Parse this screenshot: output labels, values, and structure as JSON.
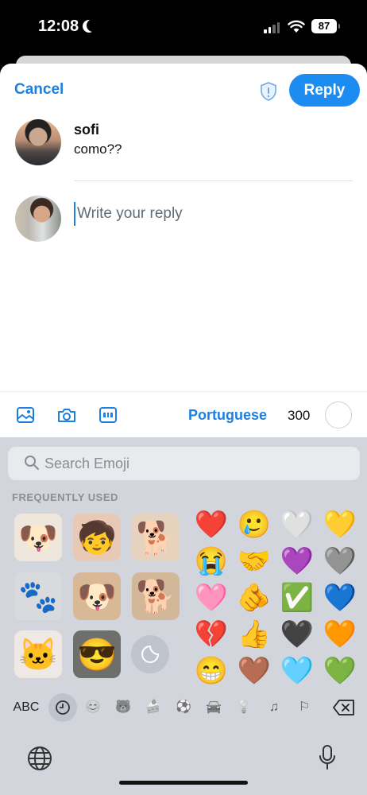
{
  "status_bar": {
    "time": "12:08",
    "battery": "87"
  },
  "header": {
    "cancel_label": "Cancel",
    "reply_label": "Reply"
  },
  "thread": {
    "user_name": "sofi",
    "message": "como??"
  },
  "composer": {
    "placeholder": "Write your reply"
  },
  "toolbar": {
    "language": "Portuguese",
    "char_count": "300"
  },
  "keyboard": {
    "search_placeholder": "Search Emoji",
    "section_label": "FREQUENTLY USED",
    "abc_label": "ABC",
    "stickers": [
      "🐶",
      "🧒",
      "🐕",
      "🐾",
      "🐶",
      "🐕",
      "🐱",
      "😎"
    ],
    "emojis": [
      "❤️",
      "🥲",
      "🤍",
      "💛",
      "😭",
      "🤝",
      "💜",
      "🩶",
      "🩷",
      "🫵",
      "✅",
      "💙",
      "💔",
      "👍",
      "🖤",
      "🧡",
      "😁",
      "🤎",
      "🩵",
      "💚"
    ],
    "categories": [
      "😊",
      "🐻",
      "🍰",
      "⚽",
      "🚘",
      "💡",
      "♫",
      "⚐"
    ]
  },
  "colors": {
    "accent": "#1d8cf0",
    "link": "#1d7fe0",
    "keyboard_bg": "#d2d5dc"
  }
}
